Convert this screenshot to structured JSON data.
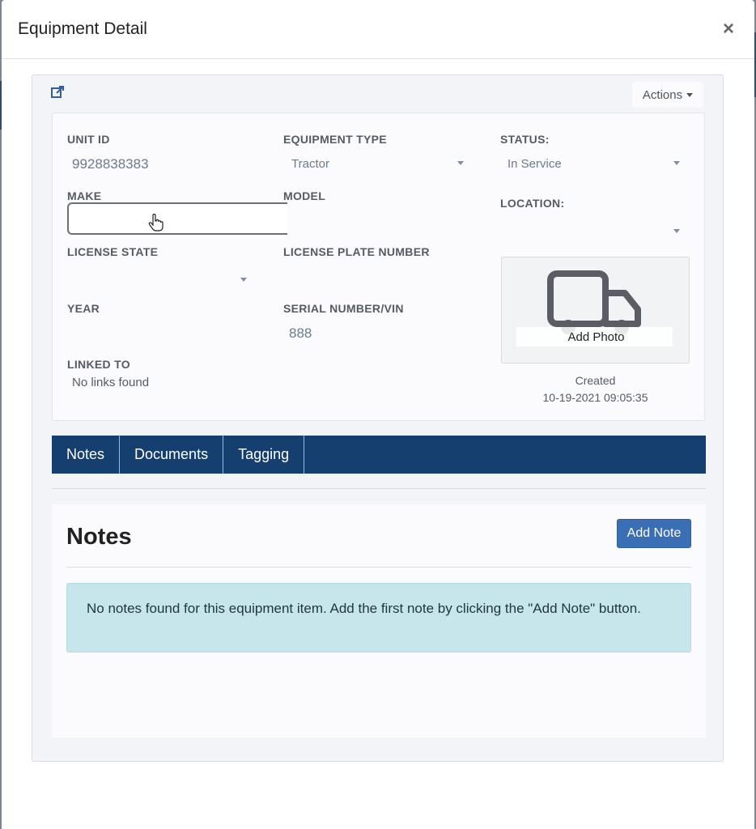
{
  "modal": {
    "title": "Equipment Detail",
    "close_glyph": "×"
  },
  "card": {
    "actions_label": "Actions",
    "fields": {
      "unit_id": {
        "label": "UNIT ID",
        "value": "9928838383"
      },
      "equipment_type": {
        "label": "EQUIPMENT TYPE",
        "value": "Tractor"
      },
      "status": {
        "label": "STATUS:",
        "value": "In Service"
      },
      "make": {
        "label": "MAKE",
        "value": ""
      },
      "model": {
        "label": "MODEL",
        "value": ""
      },
      "location": {
        "label": "LOCATION:",
        "value": ""
      },
      "license_state": {
        "label": "LICENSE STATE",
        "value": ""
      },
      "license_plate": {
        "label": "LICENSE PLATE NUMBER",
        "value": ""
      },
      "year": {
        "label": "YEAR",
        "value": ""
      },
      "serial": {
        "label": "SERIAL NUMBER/VIN",
        "value": "888"
      },
      "linked_to": {
        "label": "LINKED TO",
        "value": "No links found"
      }
    },
    "photo": {
      "label": "Add Photo",
      "icon": "truck-icon"
    },
    "created": {
      "label": "Created",
      "value": "10-19-2021 09:05:35"
    }
  },
  "tabs": [
    {
      "label": "Notes"
    },
    {
      "label": "Documents"
    },
    {
      "label": "Tagging"
    }
  ],
  "notes": {
    "title": "Notes",
    "add_button": "Add Note",
    "empty_message": "No notes found for this equipment item. Add the first note by clicking the \"Add Note\" button."
  },
  "colors": {
    "tab_bar": "#153f6f",
    "primary_button": "#3b6fb5",
    "info_alert": "#c7e6ec"
  }
}
